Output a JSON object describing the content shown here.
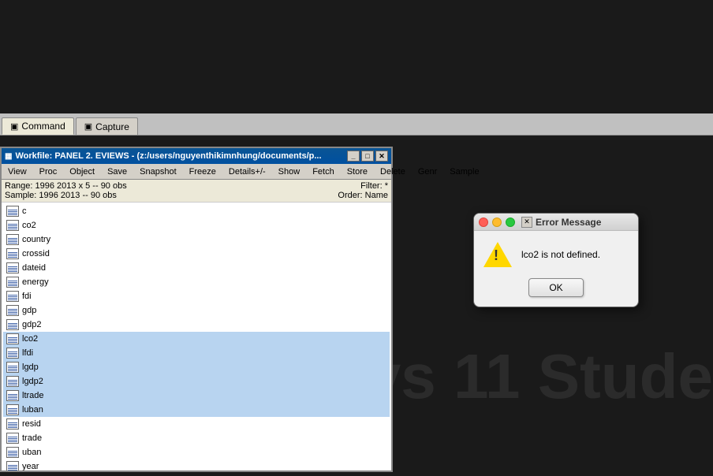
{
  "background": {
    "watermark": "vs 11 Stude"
  },
  "tabs": {
    "command": {
      "label": "Command",
      "active": true
    },
    "capture": {
      "label": "Capture",
      "active": false
    }
  },
  "workfile": {
    "title": "Workfile: PANEL 2. EVIEWS - (z:/users/nguyenthikimnhung/documents/p...",
    "menu_items": [
      "View",
      "Proc",
      "Object",
      "Save",
      "Snapshot",
      "Freeze",
      "Details+/-",
      "Show",
      "Fetch",
      "Store",
      "Delete",
      "Genr",
      "Sample"
    ],
    "range_label": "Range:",
    "range_value": "1996 2013 x 5  --  90 obs",
    "filter_label": "Filter:",
    "filter_value": "*",
    "sample_label": "Sample:",
    "sample_value": "1996 2013  --  90 obs",
    "order_label": "Order:",
    "order_value": "Name",
    "series": [
      {
        "name": "c",
        "highlighted": false
      },
      {
        "name": "co2",
        "highlighted": false
      },
      {
        "name": "country",
        "highlighted": false
      },
      {
        "name": "crossid",
        "highlighted": false
      },
      {
        "name": "dateid",
        "highlighted": false
      },
      {
        "name": "energy",
        "highlighted": false
      },
      {
        "name": "fdi",
        "highlighted": false
      },
      {
        "name": "gdp",
        "highlighted": false
      },
      {
        "name": "gdp2",
        "highlighted": false
      },
      {
        "name": "lco2",
        "highlighted": true
      },
      {
        "name": "lfdi",
        "highlighted": true
      },
      {
        "name": "lgdp",
        "highlighted": true
      },
      {
        "name": "lgdp2",
        "highlighted": true
      },
      {
        "name": "ltrade",
        "highlighted": true
      },
      {
        "name": "luban",
        "highlighted": true
      },
      {
        "name": "resid",
        "highlighted": false
      },
      {
        "name": "trade",
        "highlighted": false
      },
      {
        "name": "uban",
        "highlighted": false
      },
      {
        "name": "year",
        "highlighted": false
      }
    ]
  },
  "error_dialog": {
    "title": "Error Message",
    "message": "lco2 is not defined.",
    "ok_button": "OK",
    "traffic_lights": {
      "red": "close",
      "yellow": "minimize",
      "green": "maximize"
    }
  }
}
